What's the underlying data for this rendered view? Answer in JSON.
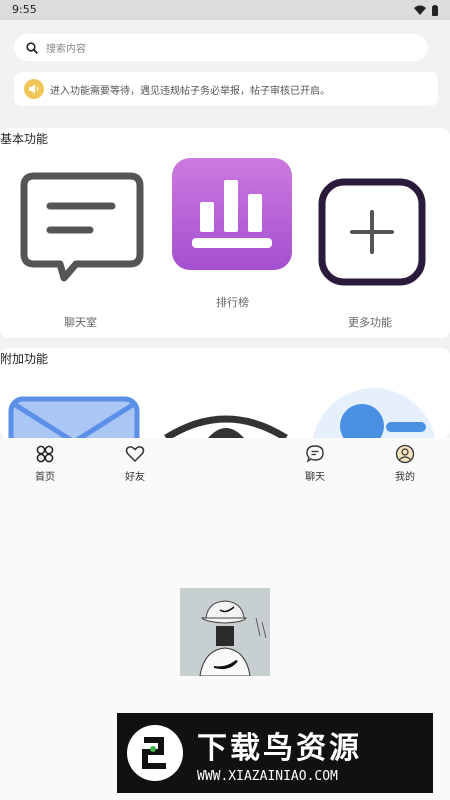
{
  "status_bar": {
    "time": "9:55"
  },
  "search": {
    "placeholder": "搜索内容"
  },
  "notice": {
    "text": "进入功能需要等待，遇见违规帖子务必举报，帖子审核已开启。"
  },
  "basic_section": {
    "title": "基本功能",
    "items": [
      {
        "label": "聊天室",
        "icon": "chat-icon"
      },
      {
        "label": "排行榜",
        "icon": "ranking-icon"
      },
      {
        "label": "更多功能",
        "icon": "plus-icon"
      }
    ]
  },
  "extra_section": {
    "title": "附加功能"
  },
  "nav": {
    "items": [
      {
        "label": "首页",
        "icon": "home-icon"
      },
      {
        "label": "好友",
        "icon": "heart-icon"
      },
      {
        "label": "聊天",
        "icon": "chat-bubble-icon"
      },
      {
        "label": "我的",
        "icon": "profile-icon"
      }
    ]
  },
  "watermark": {
    "title": "下载鸟资源",
    "url": "WWW.XIAZAINIAO.COM"
  },
  "colors": {
    "ranking_purple": "#b25ed8",
    "plus_border": "#2b1b3a",
    "mail_blue": "#5b8fe8",
    "notice_yellow": "#f0c658"
  }
}
